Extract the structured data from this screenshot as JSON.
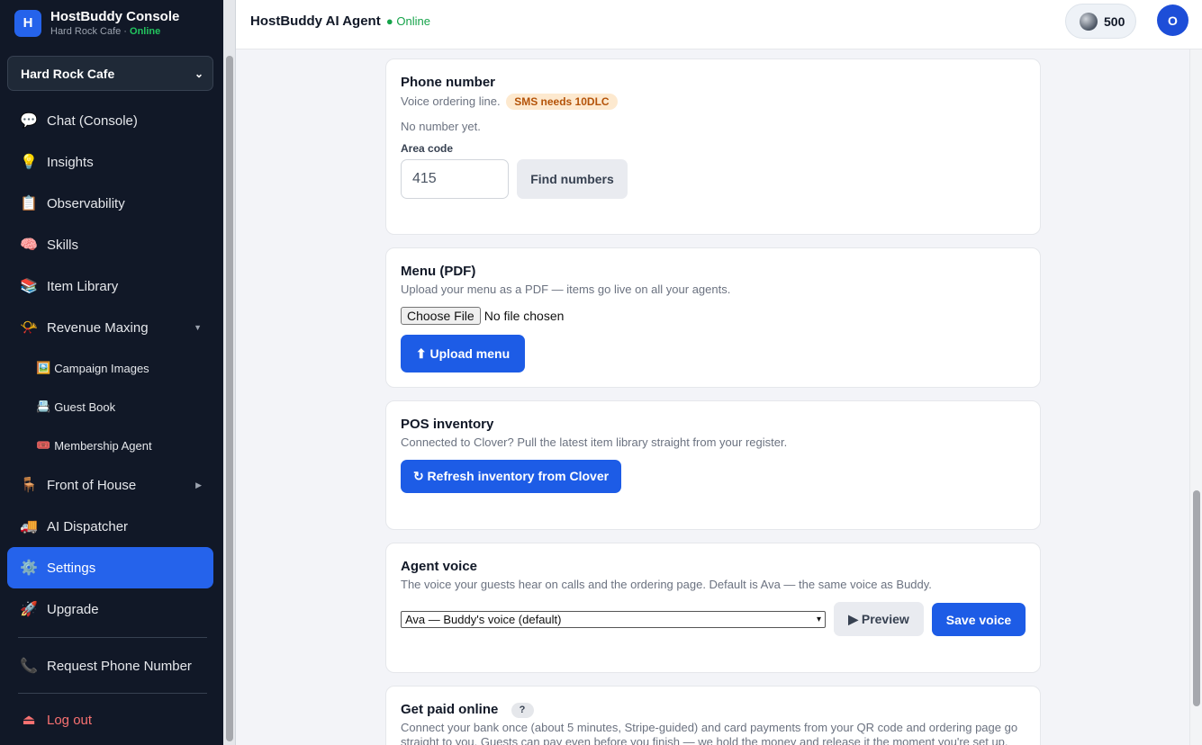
{
  "brand": {
    "logo_letter": "H",
    "title": "HostBuddy Console",
    "sub_location": "Hard Rock Cafe · ",
    "sub_status": "Online"
  },
  "location_select": {
    "value": "Hard Rock Cafe"
  },
  "nav": {
    "chat": {
      "icon": "💬",
      "label": "Chat (Console)"
    },
    "insights": {
      "icon": "💡",
      "label": "Insights"
    },
    "observability": {
      "icon": "📋",
      "label": "Observability"
    },
    "skills": {
      "icon": "🧠",
      "label": "Skills"
    },
    "item_library": {
      "icon": "📚",
      "label": "Item Library"
    },
    "revenue": {
      "icon": "📯",
      "label": "Revenue Maxing"
    },
    "campaign": {
      "icon": "🖼️",
      "label": "Campaign Images"
    },
    "guestbook": {
      "icon": "📇",
      "label": "Guest Book"
    },
    "membership": {
      "icon": "🎟️",
      "label": "Membership Agent"
    },
    "front": {
      "icon": "🪑",
      "label": "Front of House"
    },
    "dispatcher": {
      "icon": "🚚",
      "label": "AI Dispatcher"
    },
    "settings": {
      "icon": "⚙️",
      "label": "Settings"
    },
    "upgrade": {
      "icon": "🚀",
      "label": "Upgrade"
    },
    "request_phone": {
      "icon": "📞",
      "label": "Request Phone Number"
    },
    "logout": {
      "icon": "⏏",
      "label": "Log out"
    }
  },
  "topbar": {
    "title": "HostBuddy AI Agent",
    "status": "● Online",
    "credits": "500",
    "avatar_letter": "O"
  },
  "phone": {
    "title": "Phone number",
    "desc": "Voice ordering line.",
    "badge": "SMS needs 10DLC",
    "empty": "No number yet.",
    "area_label": "Area code",
    "area_value": "415",
    "find_button": "Find numbers"
  },
  "menu": {
    "title": "Menu (PDF)",
    "desc": "Upload your menu as a PDF — items go live on all your agents.",
    "choose_file": "Choose File",
    "no_file": "No file chosen",
    "upload_button": "⬆ Upload menu"
  },
  "pos": {
    "title": "POS inventory",
    "desc": "Connected to Clover? Pull the latest item library straight from your register.",
    "refresh_button": "↻ Refresh inventory from Clover"
  },
  "voice": {
    "title": "Agent voice",
    "desc": "The voice your guests hear on calls and the ordering page. Default is Ava — the same voice as Buddy.",
    "selected": "Ava — Buddy's voice (default)",
    "preview_button": "▶ Preview",
    "save_button": "Save voice"
  },
  "payments": {
    "title": "Get paid online",
    "help": "?",
    "desc1": "Connect your bank once (about 5 minutes, Stripe-guided) and card payments from your QR code and ordering page go",
    "desc2": "straight to you. Guests can pay even before you finish — we hold the money and release it the moment you're set up."
  },
  "colors": {
    "accent": "#2563eb",
    "sidebar_bg": "#111827",
    "online": "#16a34a",
    "logout": "#f87171"
  }
}
